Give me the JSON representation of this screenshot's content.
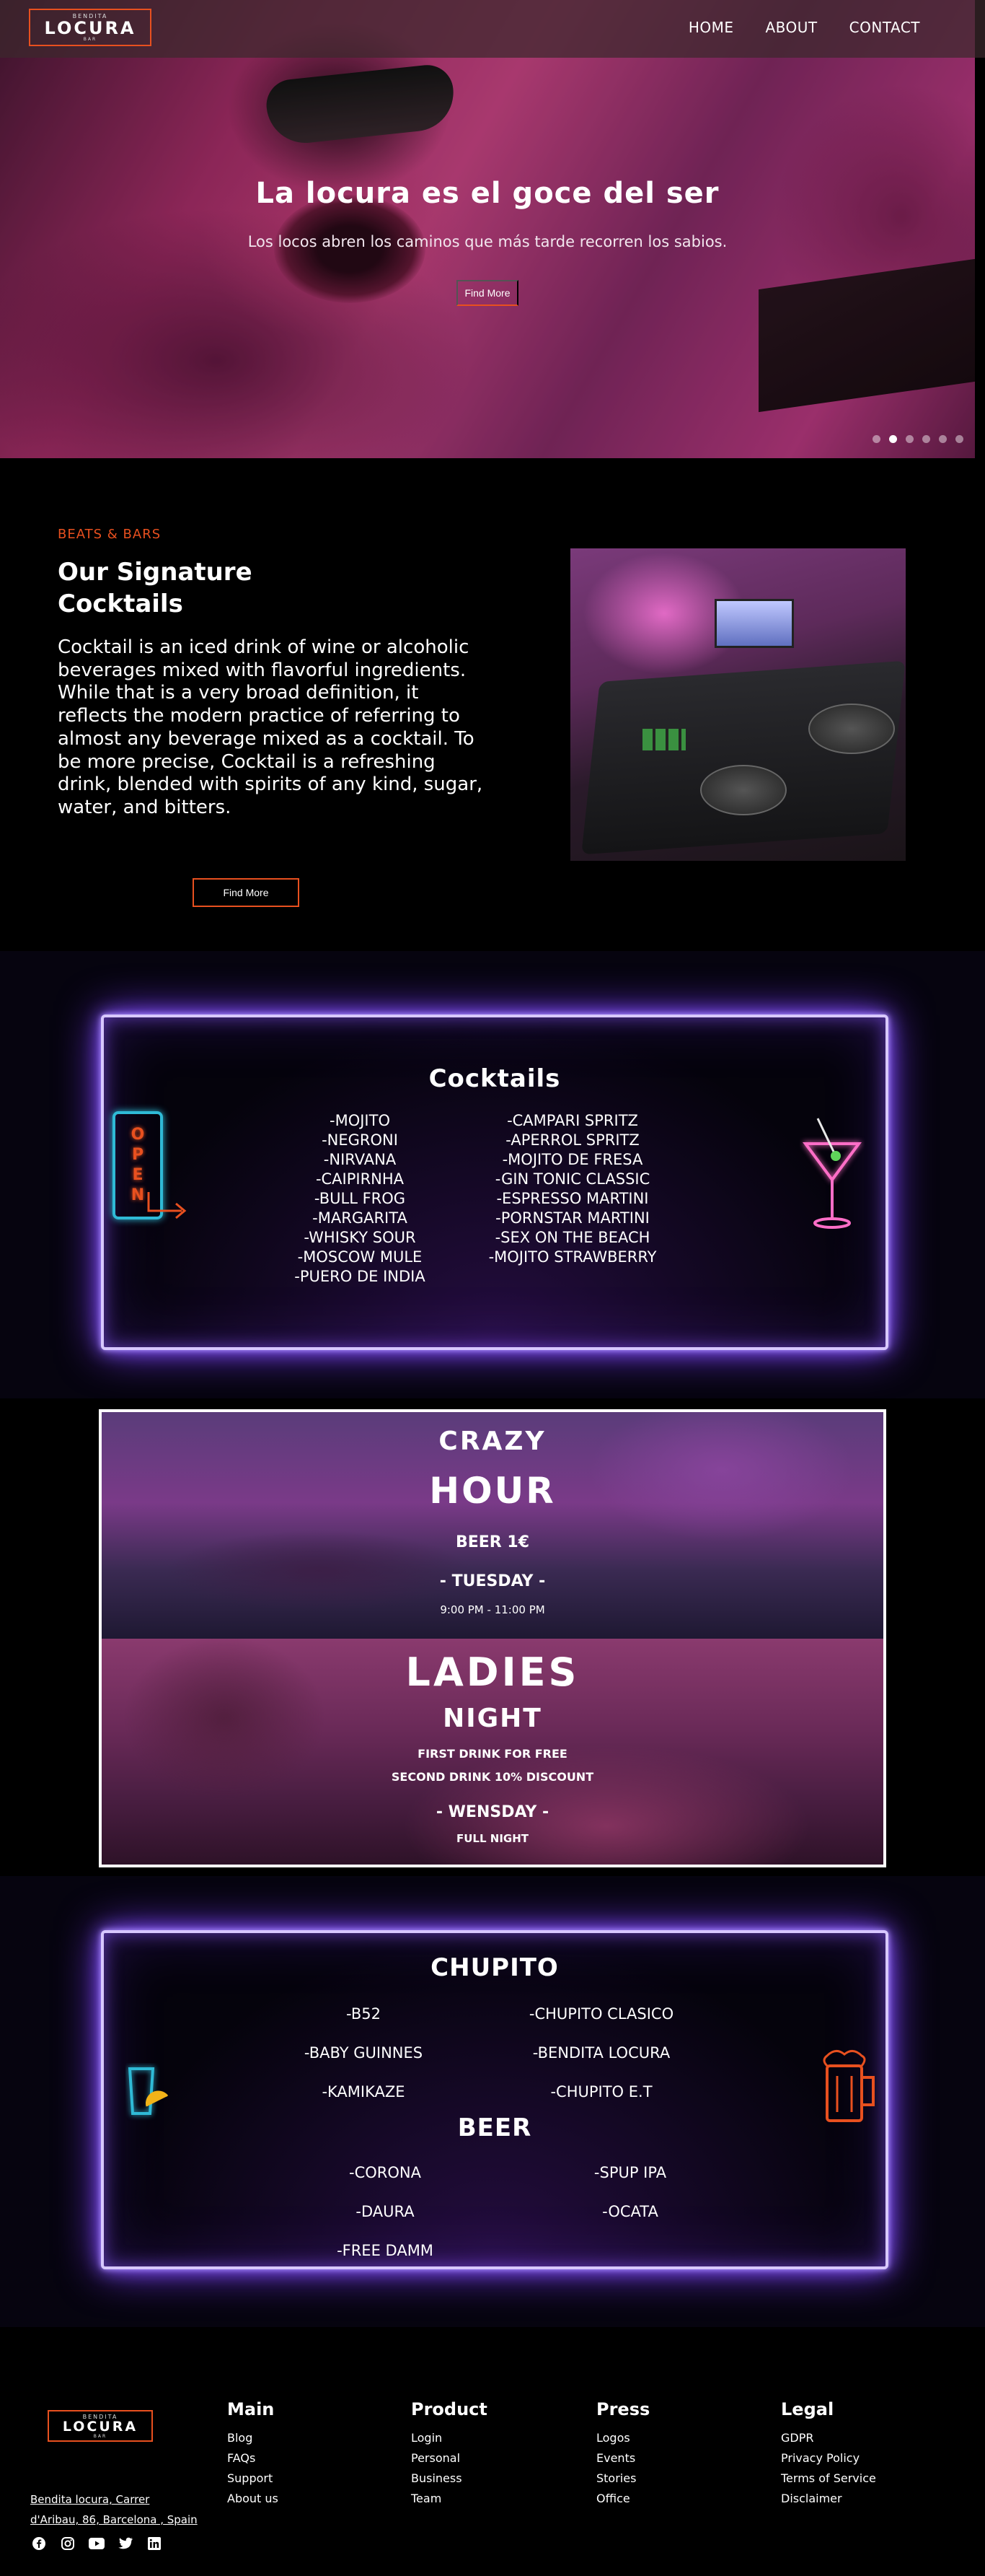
{
  "nav": {
    "logo_top": "BENDITA",
    "logo_main": "LOCURA",
    "logo_bottom": "BAR",
    "links": [
      "HOME",
      "ABOUT",
      "CONTACT"
    ]
  },
  "hero": {
    "title": "La locura es el goce del ser",
    "subtitle": "Los locos abren los caminos que más tarde recorren los sabios.",
    "button": "Find More",
    "slides_count": 6,
    "active_slide": 2
  },
  "signature": {
    "kicker": "BEATS & BARS",
    "title": "Our Signature Cocktails",
    "text": "Cocktail is an iced drink of wine or alcoholic beverages mixed with flavorful ingredients. While that is a very broad definition, it reflects the modern practice of referring to almost any beverage mixed as a cocktail. To be more precise, Cocktail is a refreshing drink, blended with spirits of any kind, sugar, water, and bitters.",
    "button": "Find More"
  },
  "cocktails": {
    "title": "Cocktails",
    "open_sign": [
      "O",
      "P",
      "E",
      "N"
    ],
    "left": [
      "-MOJITO",
      "-NEGRONI",
      "-NIRVANA",
      "-CAIPIRNHA",
      "-BULL FROG",
      "-MARGARITA",
      "-WHISKY SOUR",
      "-MOSCOW MULE",
      "-PUERO DE INDIA"
    ],
    "right": [
      "-CAMPARI SPRITZ",
      "-APERROL SPRITZ",
      "-MOJITO DE FRESA",
      "-GIN TONIC CLASSIC",
      "-ESPRESSO MARTINI",
      "-PORNSTAR MARTINI",
      "-SEX ON THE BEACH",
      "-MOJITO STRAWBERRY"
    ]
  },
  "promo": {
    "crazy": "CRAZY",
    "hour": "HOUR",
    "beer": "BEER 1€",
    "tuesday": "- TUESDAY -",
    "tuesday_time": "9:00 PM - 11:00 PM",
    "ladies": "LADIES",
    "night": "NIGHT",
    "first_drink": "FIRST DRINK FOR FREE",
    "second_drink": "SECOND DRINK 10% DISCOUNT",
    "wednesday": "- WENSDAY -",
    "full_night": "FULL NIGHT"
  },
  "chupito": {
    "title": "CHUPITO",
    "left": [
      "-B52",
      "-BABY GUINNES",
      "-KAMIKAZE"
    ],
    "right": [
      "-CHUPITO CLASICO",
      "-BENDITA LOCURA",
      "-CHUPITO E.T"
    ],
    "beer_title": "BEER",
    "beer_left": [
      "-CORONA",
      "-DAURA",
      "-FREE DAMM"
    ],
    "beer_right": [
      "-SPUP IPA",
      "-OCATA"
    ]
  },
  "footer": {
    "address_line1": "Bendita locura, Carrer",
    "address_line2": "d'Aribau, 86, Barcelona , Spain",
    "columns": [
      {
        "title": "Main",
        "links": [
          "Blog",
          "FAQs",
          "Support",
          "About us"
        ]
      },
      {
        "title": "Product",
        "links": [
          "Login",
          "Personal",
          "Business",
          "Team"
        ]
      },
      {
        "title": "Press",
        "links": [
          "Logos",
          "Events",
          "Stories",
          "Office"
        ]
      },
      {
        "title": "Legal",
        "links": [
          "GDPR",
          "Privacy Policy",
          "Terms of Service",
          "Disclaimer"
        ]
      }
    ],
    "social": [
      "facebook-icon",
      "instagram-icon",
      "youtube-icon",
      "twitter-icon",
      "linkedin-icon"
    ]
  },
  "colors": {
    "accent": "#e8501f",
    "neon": "#b49cff",
    "background": "#000000"
  }
}
